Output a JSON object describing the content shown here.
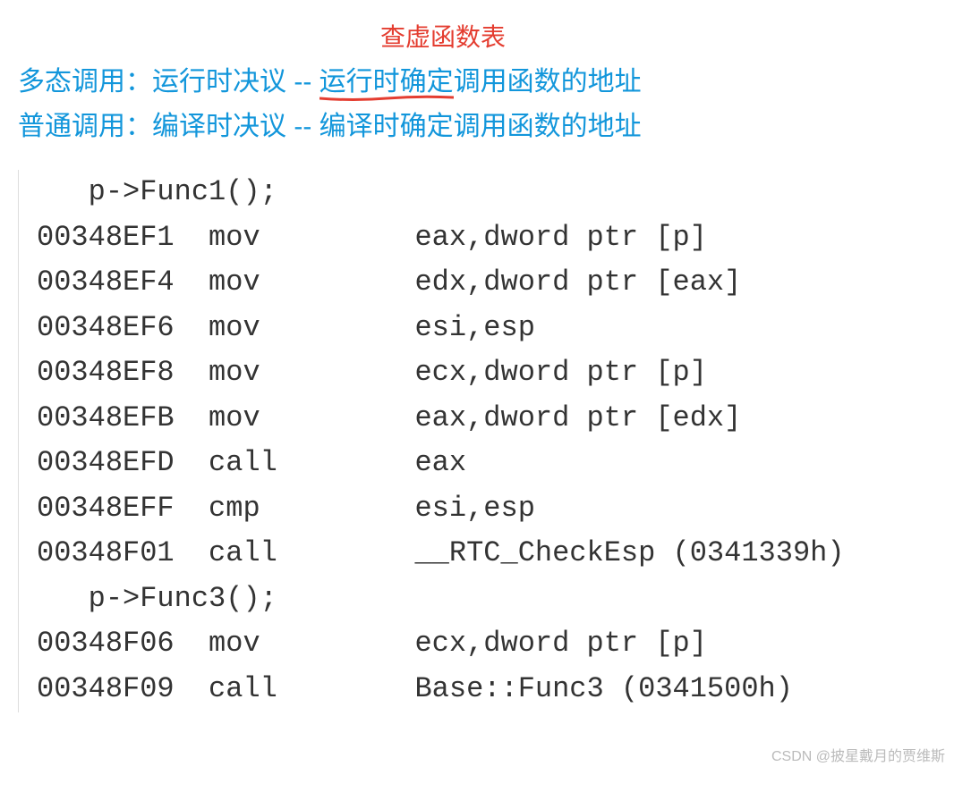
{
  "header": {
    "red_annotation": "查虚函数表",
    "line1_prefix": "多态调用：运行时决议 -- ",
    "line1_underlined": "运行时确定",
    "line1_suffix": "调用函数的地址",
    "line2": "普通调用：编译时决议 -- 编译时确定调用函数的地址"
  },
  "code": {
    "source1": "   p->Func1();",
    "lines": [
      {
        "addr": "00348EF1",
        "mnemonic": "mov",
        "operands": "eax,dword ptr [p]"
      },
      {
        "addr": "00348EF4",
        "mnemonic": "mov",
        "operands": "edx,dword ptr [eax]"
      },
      {
        "addr": "00348EF6",
        "mnemonic": "mov",
        "operands": "esi,esp"
      },
      {
        "addr": "00348EF8",
        "mnemonic": "mov",
        "operands": "ecx,dword ptr [p]"
      },
      {
        "addr": "00348EFB",
        "mnemonic": "mov",
        "operands": "eax,dword ptr [edx]"
      },
      {
        "addr": "00348EFD",
        "mnemonic": "call",
        "operands": "eax"
      },
      {
        "addr": "00348EFF",
        "mnemonic": "cmp",
        "operands": "esi,esp"
      },
      {
        "addr": "00348F01",
        "mnemonic": "call",
        "operands": "__RTC_CheckEsp (0341339h)"
      }
    ],
    "source2": "   p->Func3();",
    "lines2": [
      {
        "addr": "00348F06",
        "mnemonic": "mov",
        "operands": "ecx,dword ptr [p]"
      },
      {
        "addr": "00348F09",
        "mnemonic": "call",
        "operands": "Base::Func3 (0341500h)"
      }
    ]
  },
  "watermark": "CSDN @披星戴月的贾维斯"
}
